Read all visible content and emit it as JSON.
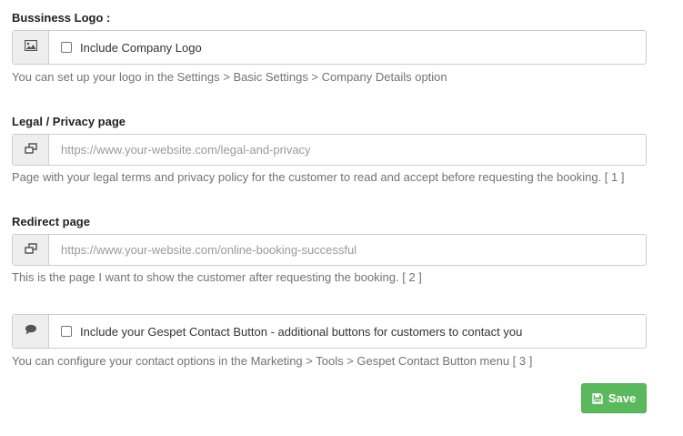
{
  "logo": {
    "label": "Bussiness Logo :",
    "checkbox_label": "Include Company Logo",
    "icon": "image-icon",
    "help": "You can set up your logo in the Settings > Basic Settings > Company Details option"
  },
  "legal": {
    "label": "Legal / Privacy page",
    "icon": "external-link-icon",
    "value": "",
    "placeholder": "https://www.your-website.com/legal-and-privacy",
    "help": "Page with your legal terms and privacy policy for the customer to read and accept before requesting the booking. [ 1 ]"
  },
  "redirect": {
    "label": "Redirect page",
    "icon": "external-link-icon",
    "value": "",
    "placeholder": "https://www.your-website.com/online-booking-successful",
    "help": "This is the page I want to show the customer after requesting the booking. [ 2 ]"
  },
  "contact": {
    "icon": "speech-bubble-icon",
    "checkbox_label": "Include your Gespet Contact Button - additional buttons for customers to contact you",
    "help": "You can configure your contact options in the Marketing > Tools > Gespet Contact Button menu [ 3 ]"
  },
  "save": {
    "label": "Save",
    "icon": "floppy-disk-icon",
    "color": "#5cb85c"
  }
}
